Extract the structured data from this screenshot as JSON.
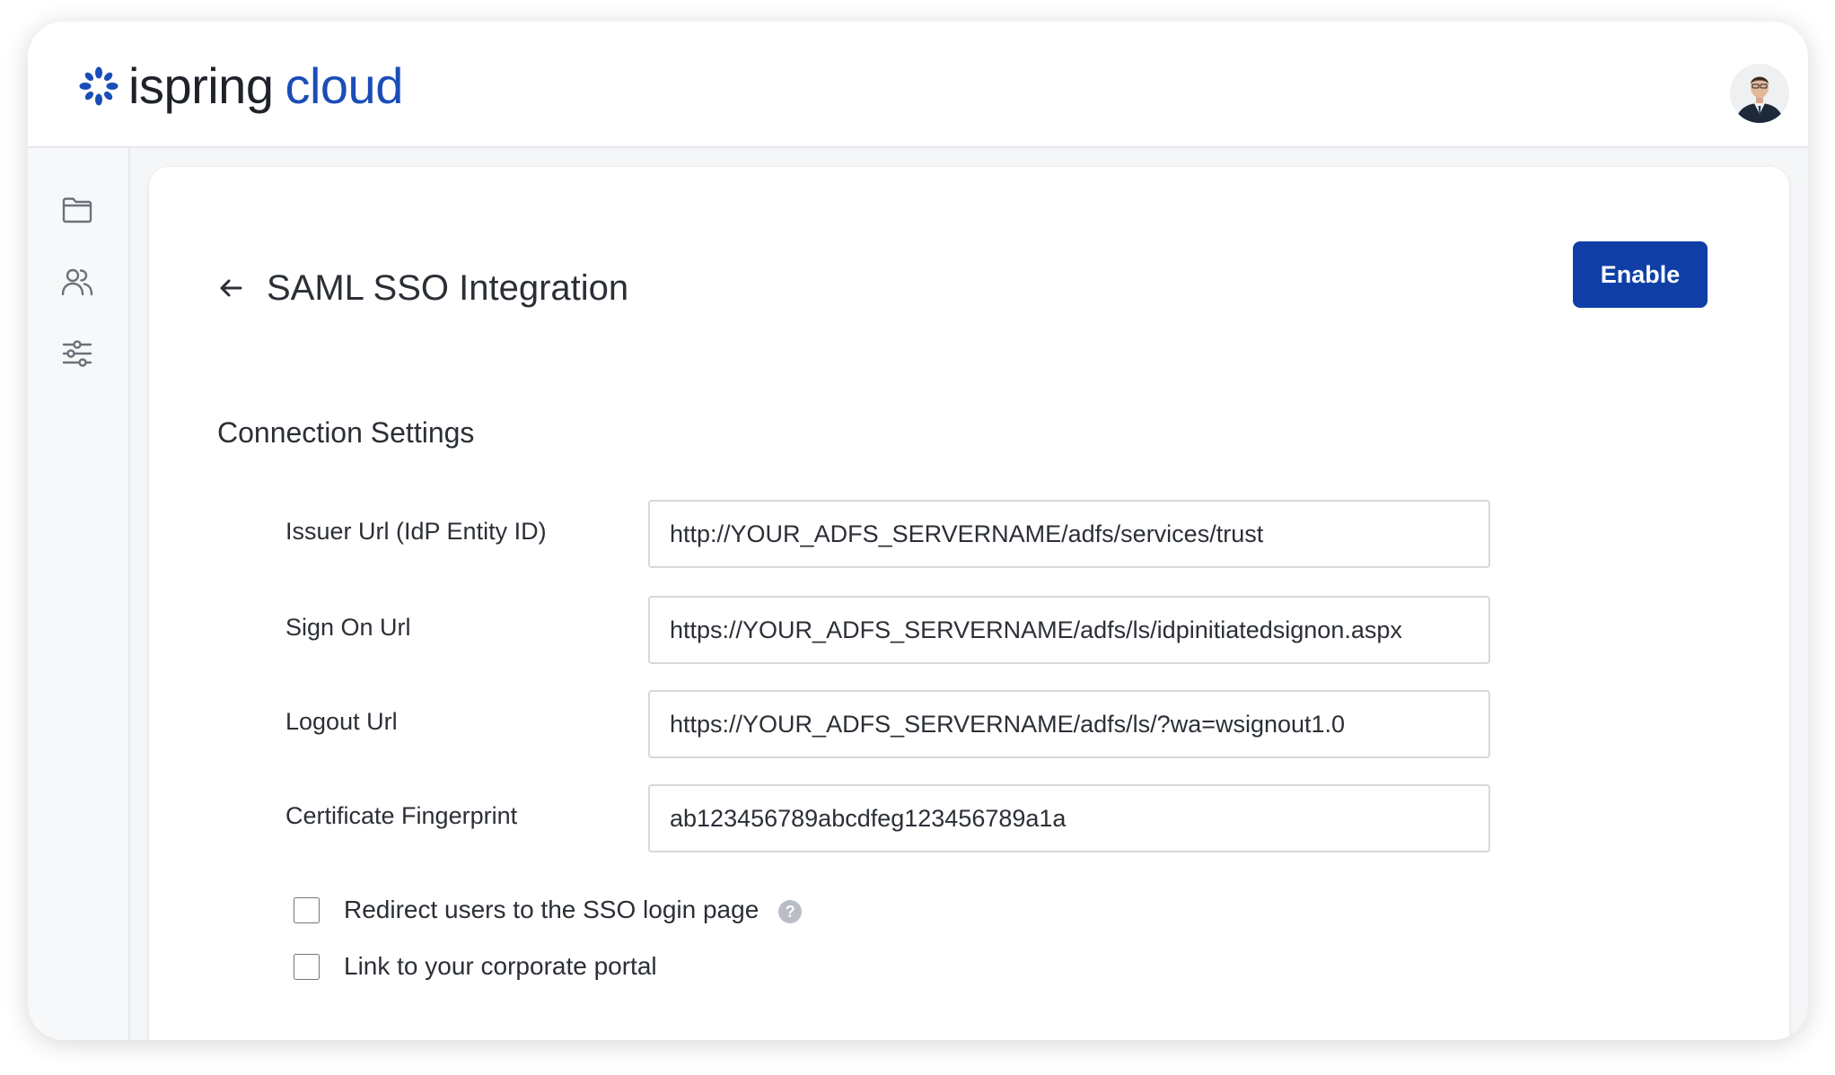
{
  "brand": {
    "word1": "ispring",
    "word2": "cloud",
    "accent_color": "#1a4db8",
    "mark_color": "#1a4db8"
  },
  "header": {
    "avatar_icon": "user-avatar"
  },
  "sidebar": {
    "items": [
      {
        "icon": "folder-icon",
        "label": "Content"
      },
      {
        "icon": "users-icon",
        "label": "Users"
      },
      {
        "icon": "settings-sliders-icon",
        "label": "Settings"
      }
    ]
  },
  "page": {
    "title": "SAML SSO Integration",
    "enable_label": "Enable",
    "enable_color": "#0f3fa6",
    "section_title": "Connection Settings"
  },
  "fields": [
    {
      "label": "Issuer Url (IdP Entity ID)",
      "value": "http://YOUR_ADFS_SERVERNAME/adfs/services/trust"
    },
    {
      "label": "Sign On Url",
      "value": "https://YOUR_ADFS_SERVERNAME/adfs/ls/idpinitiatedsignon.aspx"
    },
    {
      "label": "Logout Url",
      "value": "https://YOUR_ADFS_SERVERNAME/adfs/ls/?wa=wsignout1.0"
    },
    {
      "label": "Certificate Fingerprint",
      "value": "ab123456789abcdfeg123456789a1a"
    }
  ],
  "options": [
    {
      "label": "Redirect users to the SSO login page",
      "checked": false,
      "help_glyph": "?"
    },
    {
      "label": "Link to your corporate portal",
      "checked": false
    }
  ]
}
